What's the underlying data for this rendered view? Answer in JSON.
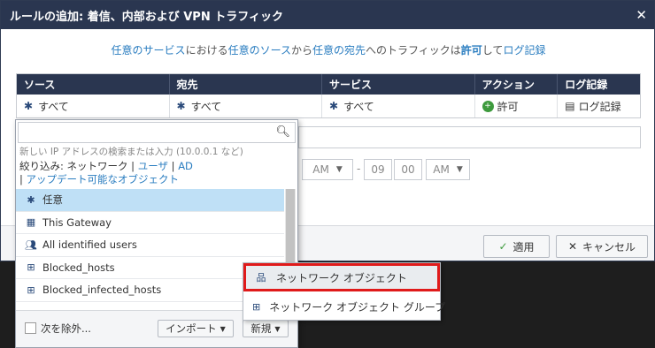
{
  "dialog": {
    "title": "ルールの追加: 着信、内部および VPN トラフィック",
    "close": "✕"
  },
  "summary": {
    "p1": "任意のサービス",
    "p2": "における",
    "p3": "任意のソース",
    "p4": "から",
    "p5": "任意の宛先",
    "p6": "へのトラフィックは",
    "p7": "許可",
    "p8": "して",
    "p9": "ログ記録"
  },
  "grid": {
    "headers": [
      "ソース",
      "宛先",
      "サービス",
      "アクション",
      "ログ記録"
    ],
    "row": {
      "source": "すべて",
      "destination": "すべて",
      "service": "すべて",
      "action": "許可",
      "logging": "ログ記録"
    }
  },
  "schedule": {
    "ampm1": "AM",
    "dash": "-",
    "hour": "09",
    "minute": "00",
    "ampm2": "AM"
  },
  "footer": {
    "apply": "適用",
    "cancel": "キャンセル"
  },
  "picker": {
    "search_placeholder": "",
    "hint": "新しい IP アドレスの検索または入力 (10.0.0.1 など)",
    "filter_prefix": "絞り込み: ネットワーク | ",
    "filter_user": "ユーザ",
    "filter_sep": " | ",
    "filter_ad": "AD",
    "filter_line2_prefix": "| ",
    "filter_updatable": "アップデート可能なオブジェクト",
    "items": [
      {
        "label": "任意",
        "icon": "asterisk-icon"
      },
      {
        "label": "This Gateway",
        "icon": "gateway-icon"
      },
      {
        "label": "All identified users",
        "icon": "users-icon"
      },
      {
        "label": "Blocked_hosts",
        "icon": "network-group-icon"
      },
      {
        "label": "Blocked_infected_hosts",
        "icon": "network-group-icon"
      }
    ],
    "exclude_label": "次を除外...",
    "import_label": "インポート",
    "new_label": "新規"
  },
  "new_menu": {
    "items": [
      {
        "label": "ネットワーク オブジェクト",
        "icon": "network-object-icon"
      },
      {
        "label": "ネットワーク オブジェクト グループ",
        "icon": "network-group-icon"
      }
    ]
  },
  "colors": {
    "titlebar": "#2a3650",
    "link": "#2a7dc0",
    "selection": "#bfe0f6",
    "highlight_border": "#e01a1a"
  }
}
